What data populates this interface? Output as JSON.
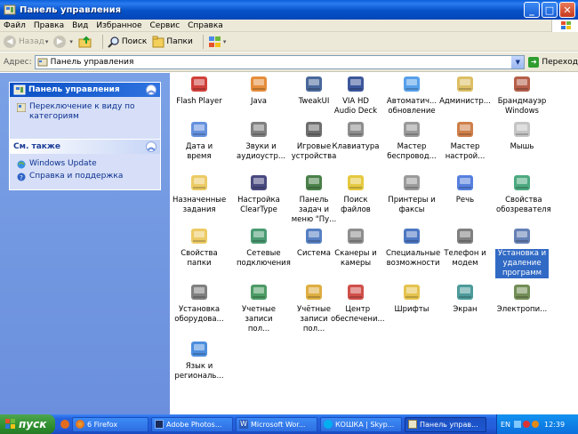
{
  "window": {
    "title": "Панель управления",
    "buttons": {
      "minimize": "_",
      "maximize": "□",
      "close": "✕"
    }
  },
  "menu": [
    "Файл",
    "Правка",
    "Вид",
    "Избранное",
    "Сервис",
    "Справка"
  ],
  "toolbar": {
    "back": "Назад",
    "search": "Поиск",
    "folders": "Папки"
  },
  "address": {
    "label": "Адрес:",
    "value": "Панель управления",
    "go": "Переход"
  },
  "sidebar": {
    "main_panel": {
      "title": "Панель управления",
      "links": [
        "Переключение к виду по категориям"
      ]
    },
    "see_also": {
      "title": "См. также",
      "links": [
        "Windows Update",
        "Справка и поддержка"
      ]
    }
  },
  "items": [
    {
      "label": "Flash Player",
      "icon": "flash-icon"
    },
    {
      "label": "Java",
      "icon": "java-icon"
    },
    {
      "label": "TweakUI",
      "icon": "tweakui-icon"
    },
    {
      "label": "VIA HD Audio Deck",
      "icon": "audio-deck-icon"
    },
    {
      "label": "Автоматич... обновление",
      "icon": "auto-update-icon"
    },
    {
      "label": "Администр...",
      "icon": "admin-tools-icon"
    },
    {
      "label": "Брандмауэр Windows",
      "icon": "firewall-icon"
    },
    {
      "label": "Дата и время",
      "icon": "calendar-icon"
    },
    {
      "label": "Звуки и аудиоустр...",
      "icon": "speaker-icon"
    },
    {
      "label": "Игровые устройства",
      "icon": "gamepad-icon"
    },
    {
      "label": "Клавиатура",
      "icon": "keyboard-icon"
    },
    {
      "label": "Мастер беспровод...",
      "icon": "wireless-wizard-icon"
    },
    {
      "label": "Мастер настрой...",
      "icon": "network-wizard-icon"
    },
    {
      "label": "Мышь",
      "icon": "mouse-icon"
    },
    {
      "label": "Назначенные задания",
      "icon": "scheduled-tasks-icon"
    },
    {
      "label": "Настройка ClearType",
      "icon": "cleartype-icon"
    },
    {
      "label": "Панель задач и меню \"Пу...",
      "icon": "taskbar-icon"
    },
    {
      "label": "Поиск файлов",
      "icon": "search-files-icon"
    },
    {
      "label": "Принтеры и факсы",
      "icon": "printer-icon"
    },
    {
      "label": "Речь",
      "icon": "speech-icon"
    },
    {
      "label": "Свойства обозревателя",
      "icon": "internet-options-icon"
    },
    {
      "label": "Свойства папки",
      "icon": "folder-options-icon"
    },
    {
      "label": "Сетевые подключения",
      "icon": "network-connections-icon"
    },
    {
      "label": "Система",
      "icon": "system-icon"
    },
    {
      "label": "Сканеры и камеры",
      "icon": "scanner-icon"
    },
    {
      "label": "Специальные возможности",
      "icon": "accessibility-icon"
    },
    {
      "label": "Телефон и модем",
      "icon": "phone-icon"
    },
    {
      "label": "Установка и удаление программ",
      "icon": "add-remove-programs-icon"
    },
    {
      "label": "Установка оборудова...",
      "icon": "add-hardware-icon"
    },
    {
      "label": "Учетные записи пол...",
      "icon": "user-accounts-icon"
    },
    {
      "label": "Учётные записи пол...",
      "icon": "user-accounts-lock-icon"
    },
    {
      "label": "Центр обеспечени...",
      "icon": "security-center-icon"
    },
    {
      "label": "Шрифты",
      "icon": "fonts-icon"
    },
    {
      "label": "Экран",
      "icon": "display-icon"
    },
    {
      "label": "Электропи...",
      "icon": "power-icon"
    },
    {
      "label": "Язык и региональ...",
      "icon": "regional-icon"
    }
  ],
  "selected_item": "Установка и удаление программ",
  "taskbar": {
    "start": "пуск",
    "tasks": [
      {
        "label": "6 Firefox",
        "icon": "firefox-icon"
      },
      {
        "label": "Adobe Photos...",
        "icon": "photoshop-icon"
      },
      {
        "label": "Microsoft Wor...",
        "icon": "word-icon"
      },
      {
        "label": "КОШКА | Skyp...",
        "icon": "skype-icon"
      },
      {
        "label": "Панель управ...",
        "icon": "control-panel-icon"
      }
    ],
    "lang": "EN",
    "clock": "12:39"
  },
  "colors": {
    "xp_blue": "#0651c8",
    "pane_blue": "#6b8fdd",
    "selection": "#316ac5",
    "start_green": "#2f8f2f"
  }
}
